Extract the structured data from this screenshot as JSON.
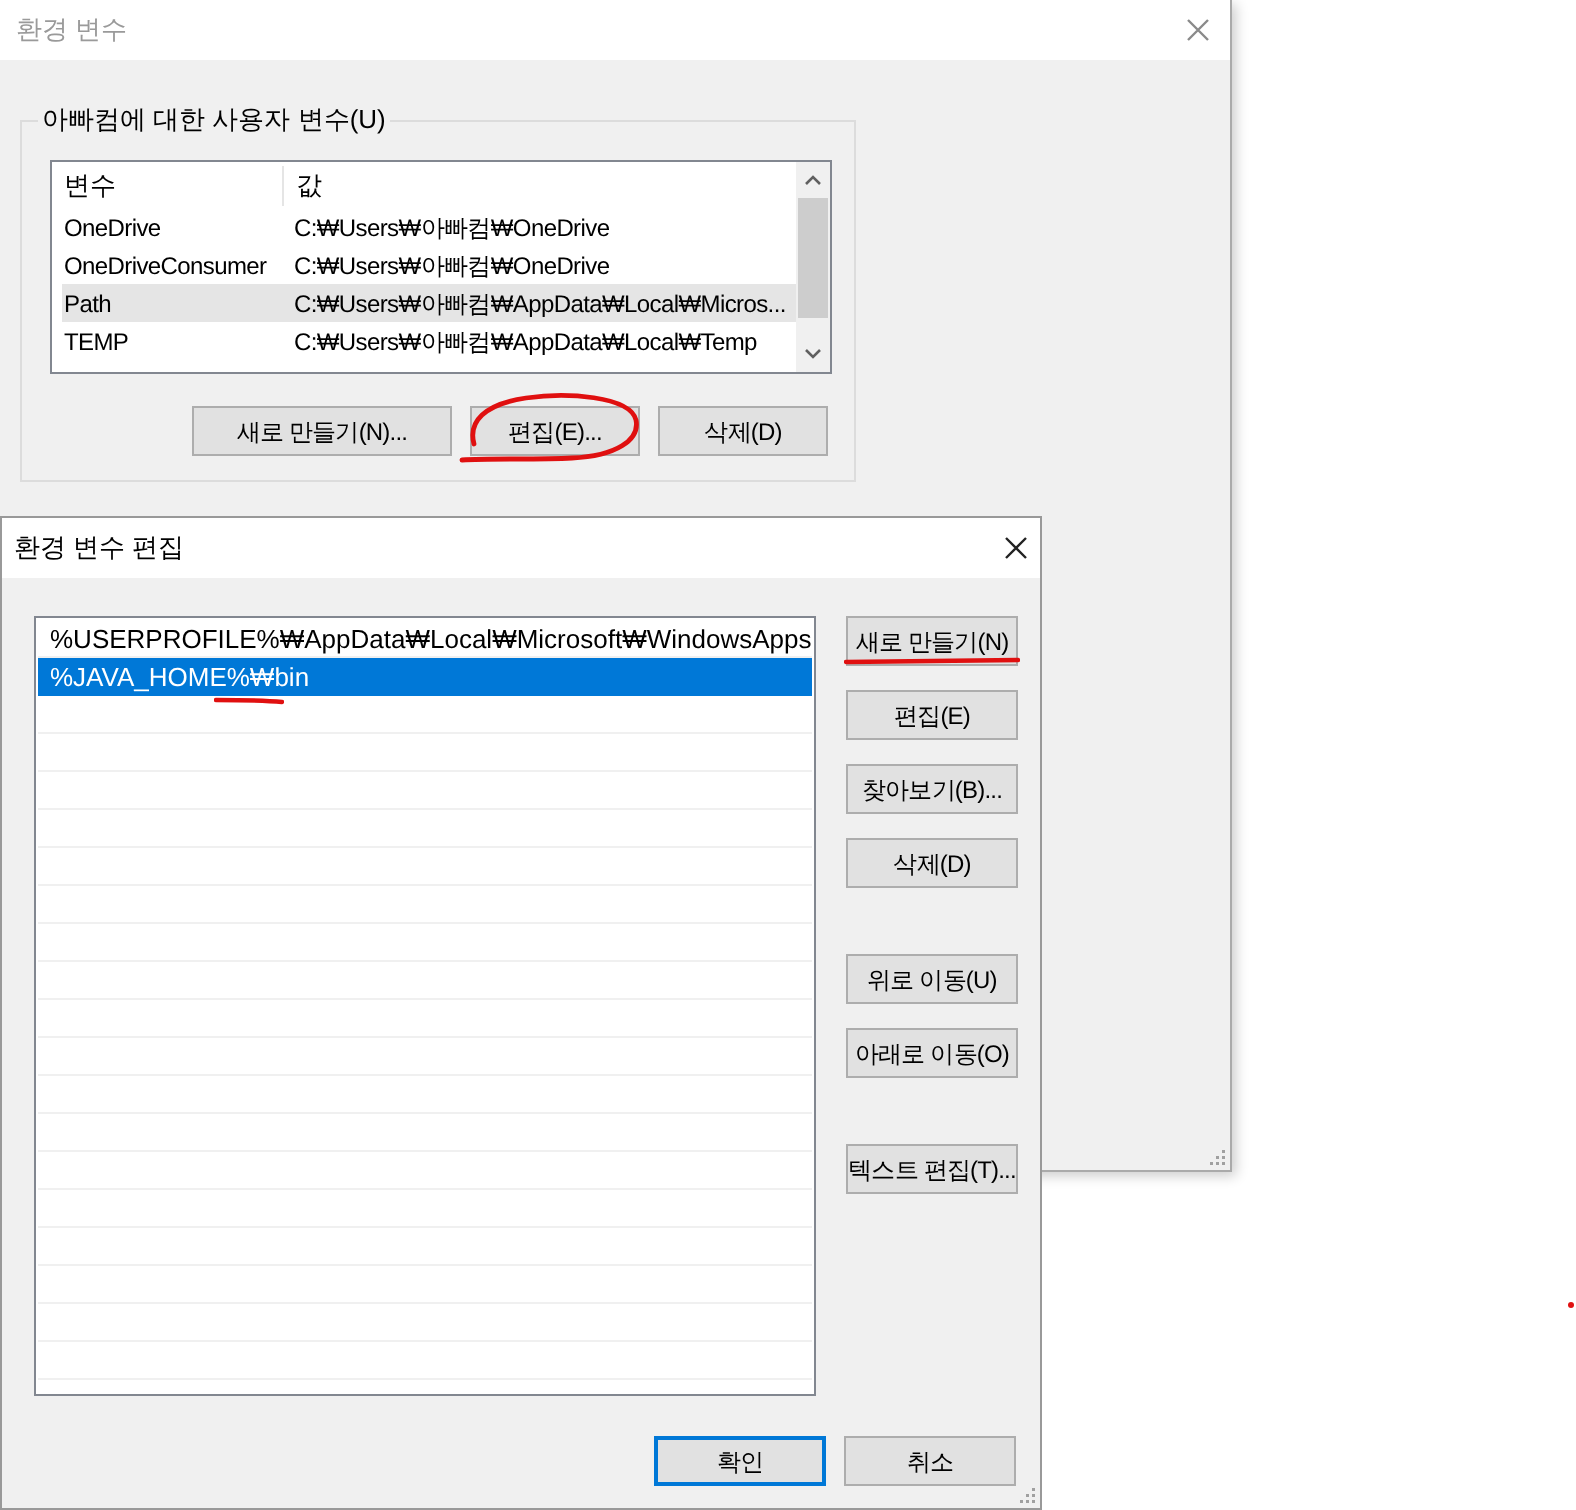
{
  "back_window": {
    "title": "환경 변수",
    "user_group": {
      "label": "아빠컴에 대한 사용자 변수(U)",
      "columns": [
        "변수",
        "값"
      ],
      "rows": [
        {
          "name": "OneDrive",
          "value": "C:₩Users₩아빠컴₩OneDrive",
          "selected": false
        },
        {
          "name": "OneDriveConsumer",
          "value": "C:₩Users₩아빠컴₩OneDrive",
          "selected": false
        },
        {
          "name": "Path",
          "value": "C:₩Users₩아빠컴₩AppData₩Local₩Micros...",
          "selected": true
        },
        {
          "name": "TEMP",
          "value": "C:₩Users₩아빠컴₩AppData₩Local₩Temp",
          "selected": false
        }
      ],
      "buttons": [
        "새로 만들기(N)...",
        "편집(E)...",
        "삭제(D)"
      ]
    }
  },
  "edit_window": {
    "title": "환경 변수 편집",
    "entries": [
      {
        "text": "%USERPROFILE%₩AppData₩Local₩Microsoft₩WindowsApps",
        "selected": false
      },
      {
        "text": "%JAVA_HOME%₩bin",
        "selected": true
      }
    ],
    "side_button_groups": [
      [
        "새로 만들기(N)",
        "편집(E)",
        "찾아보기(B)...",
        "삭제(D)"
      ],
      [
        "위로 이동(U)",
        "아래로 이동(O)"
      ],
      [
        "텍스트 편집(T)..."
      ]
    ],
    "ok": "확인",
    "cancel": "취소"
  }
}
